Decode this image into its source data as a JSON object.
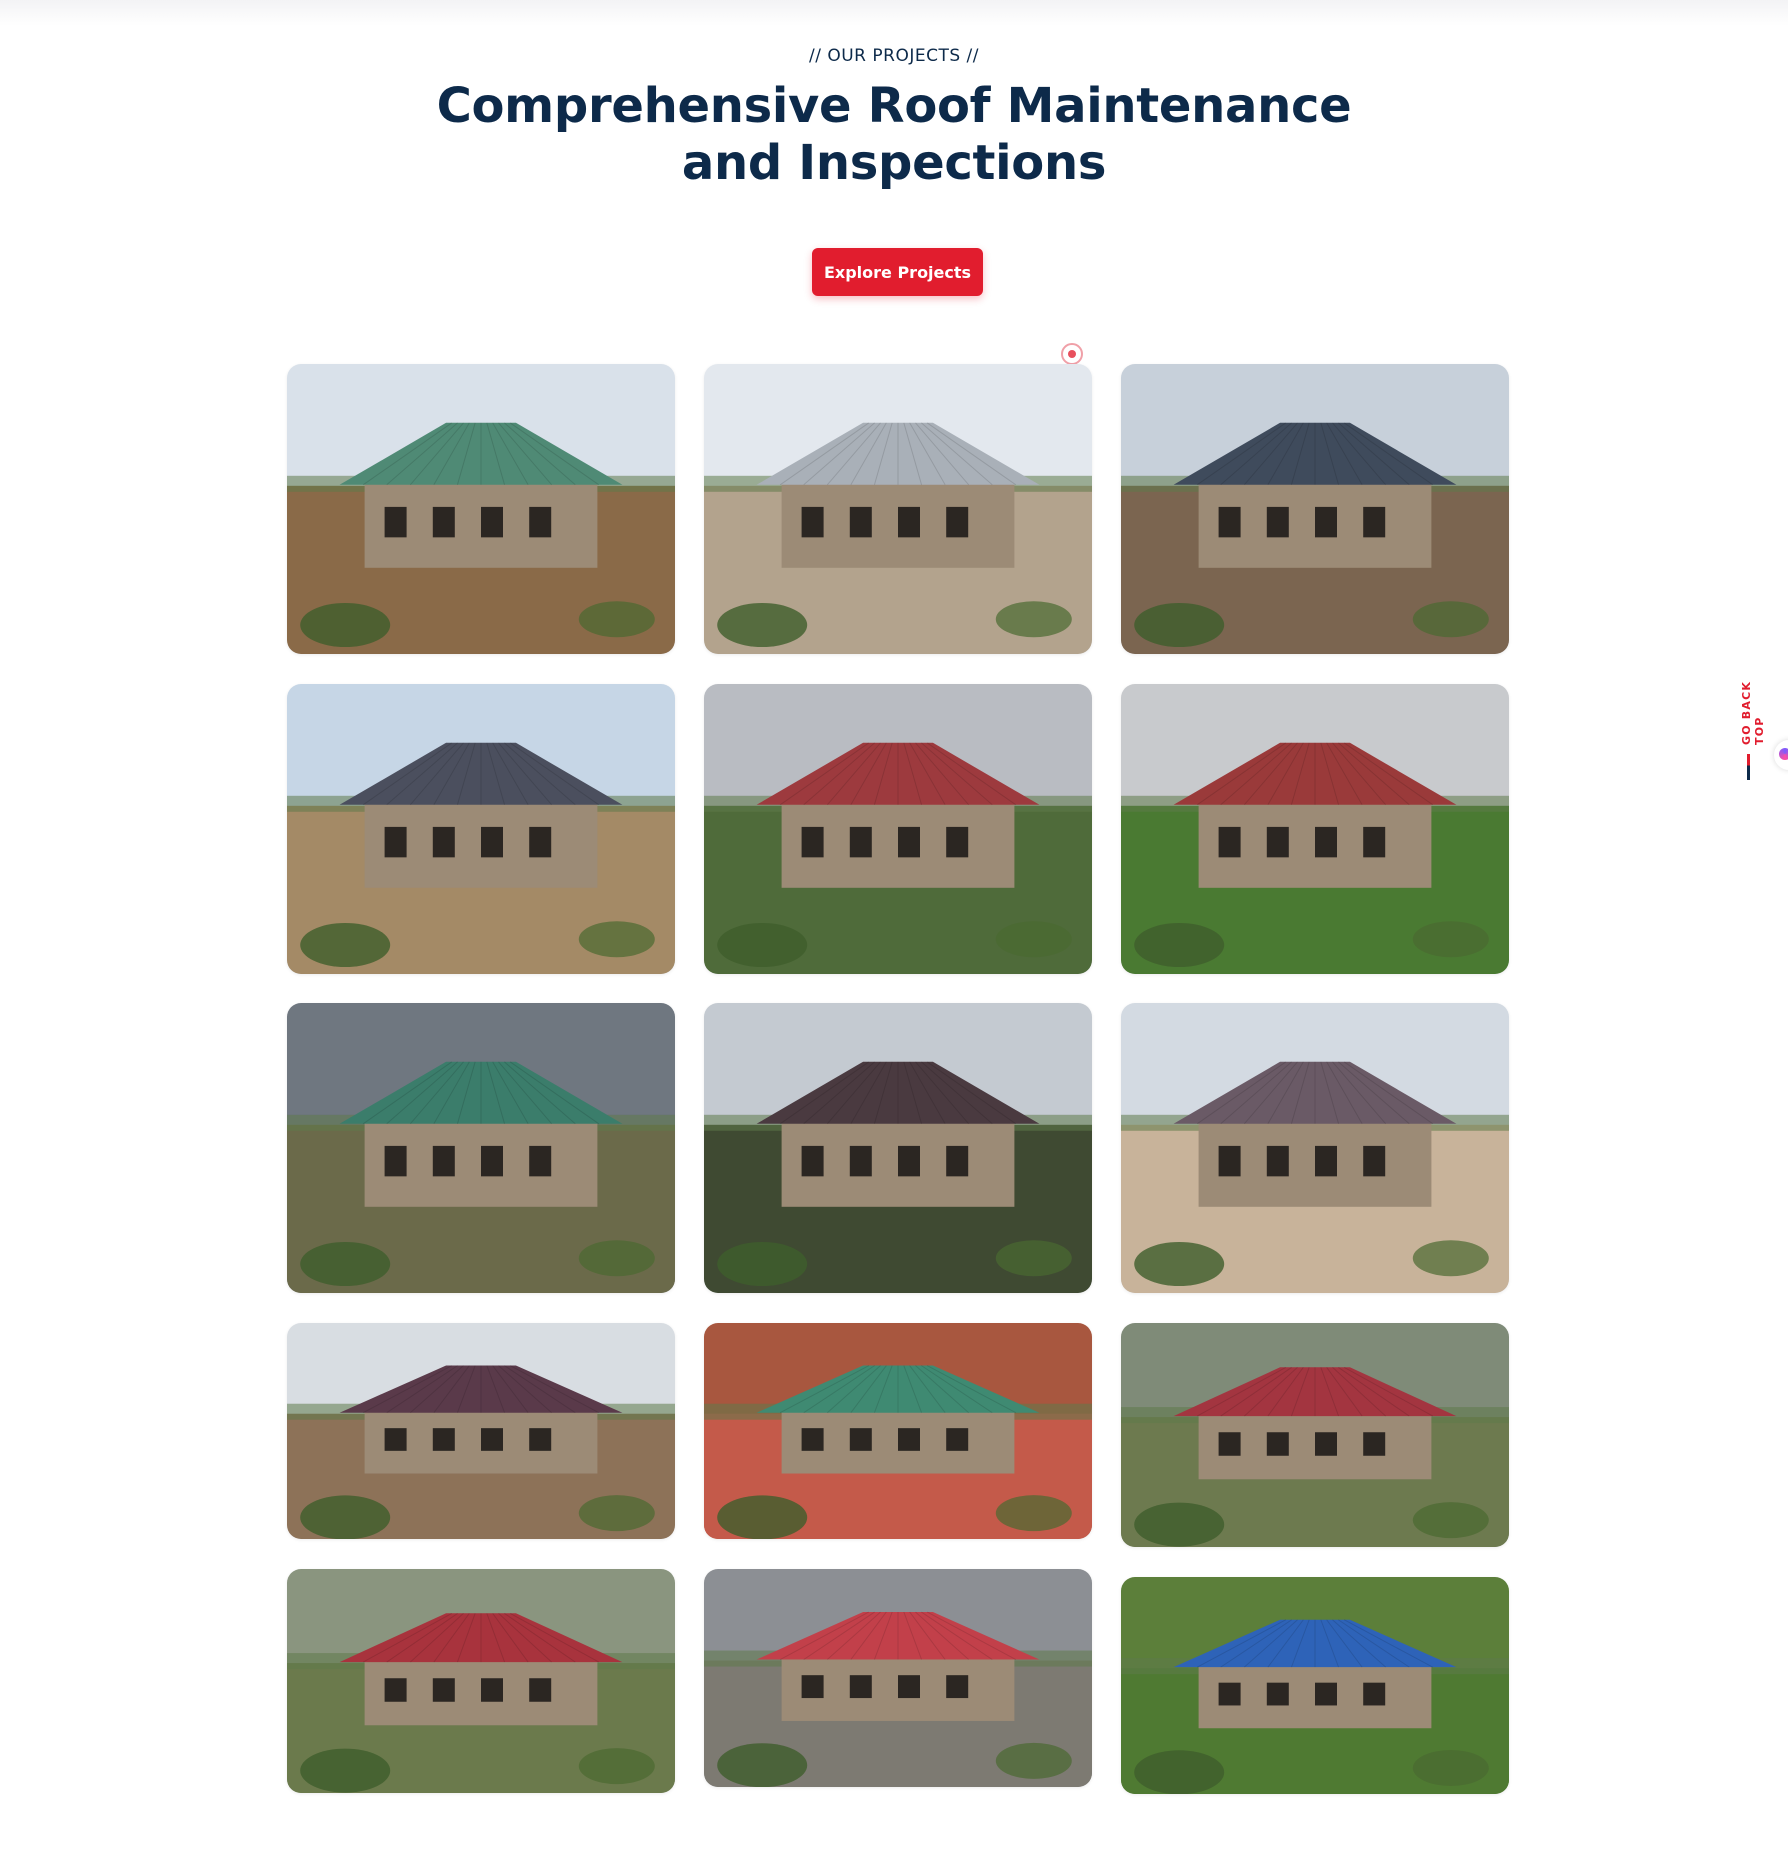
{
  "section": {
    "eyebrow": "// OUR PROJECTS //",
    "title_line1": "Comprehensive Roof Maintenance",
    "title_line2": "and Inspections",
    "cta_label": "Explore Projects"
  },
  "back_to_top": {
    "label": "GO BACK TOP"
  },
  "colors": {
    "accent": "#e11d2e",
    "heading": "#0d2a4a"
  },
  "gallery": {
    "items": [
      {
        "roof": "#4f8a75",
        "sky": "#d9e1ea",
        "ground": "#8a6a48"
      },
      {
        "roof": "#a9b0b8",
        "sky": "#e3e8ee",
        "ground": "#b3a38d"
      },
      {
        "roof": "#3f4b5c",
        "sky": "#c7d0da",
        "ground": "#7b6550"
      },
      {
        "roof": "#4b4f5e",
        "sky": "#c6d6e6",
        "ground": "#a48a66"
      },
      {
        "roof": "#9d3a3e",
        "sky": "#b9bcc2",
        "ground": "#4f6b3a"
      },
      {
        "roof": "#9a3a3a",
        "sky": "#c8cacd",
        "ground": "#4a7a32"
      },
      {
        "roof": "#3b7d6b",
        "sky": "#6f7780",
        "ground": "#6b6a4a"
      },
      {
        "roof": "#4a3a40",
        "sky": "#c4cad1",
        "ground": "#3f4a32"
      },
      {
        "roof": "#6a5a66",
        "sky": "#d3dae2",
        "ground": "#c8b39a"
      },
      {
        "roof": "#5a3a4a",
        "sky": "#d8dde2",
        "ground": "#8d7258"
      },
      {
        "roof": "#3f8a72",
        "sky": "#a8573f",
        "ground": "#c45a4a"
      },
      {
        "roof": "#a33540",
        "sky": "#7f8b78",
        "ground": "#6d7a4f"
      },
      {
        "roof": "#a8333d",
        "sky": "#8a957f",
        "ground": "#6b7a4c"
      },
      {
        "roof": "#c2404a",
        "sky": "#8c8f94",
        "ground": "#7d7a72"
      },
      {
        "roof": "#2e63b8",
        "sky": "#5c7f3a",
        "ground": "#4f7a32"
      }
    ]
  }
}
